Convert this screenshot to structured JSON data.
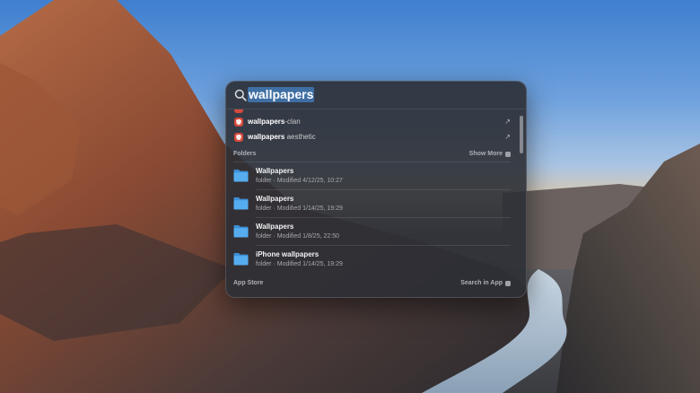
{
  "spotlight": {
    "query": "wallpapers",
    "suggestions": [
      {
        "match": "wallpapers",
        "rest": "-clan",
        "icon": "brave-browser-icon",
        "action": "↗"
      },
      {
        "match": "wallpapers",
        "rest": " aesthetic",
        "icon": "brave-browser-icon",
        "action": "↗"
      }
    ],
    "folders_section": {
      "label": "Folders",
      "action": "Show More"
    },
    "folders": [
      {
        "name": "Wallpapers",
        "meta": "folder · Modified 4/12/25, 10:27",
        "icon": "folder-icon"
      },
      {
        "name": "Wallpapers",
        "meta": "folder · Modified 1/14/25, 19:29",
        "icon": "folder-icon"
      },
      {
        "name": "Wallpapers",
        "meta": "folder · Modified 1/8/25, 22:50",
        "icon": "folder-icon"
      },
      {
        "name": "iPhone wallpapers",
        "meta": "folder · Modified 1/14/25, 19:29",
        "icon": "folder-icon"
      }
    ],
    "appstore_section": {
      "label": "App Store",
      "action": "Search in App"
    }
  },
  "colors": {
    "selection": "#3f6fa3",
    "folder": "#4aa3e8",
    "brave": "#d64a3d"
  }
}
